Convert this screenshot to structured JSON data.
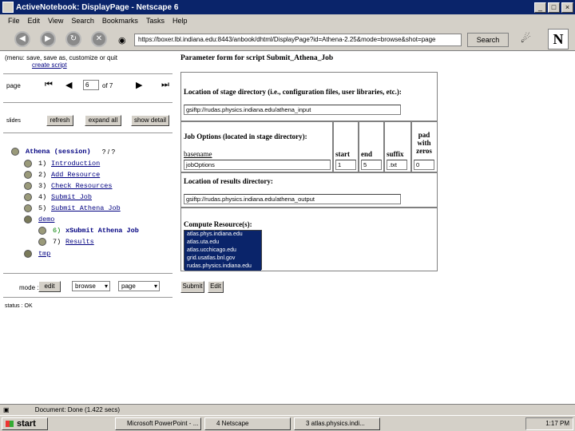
{
  "window": {
    "title": "ActiveNotebook: DisplayPage - Netscape 6"
  },
  "menu": [
    "File",
    "Edit",
    "View",
    "Search",
    "Bookmarks",
    "Tasks",
    "Help"
  ],
  "nav": {
    "url": "https://boxer.lbl.indiana.edu:8443/anbook/dhtml/DisplayPage?id=Athena-2.25&mode=browse&shot=page",
    "search_label": "Search"
  },
  "left": {
    "top_links": "(menu: save, save as, customize or quit",
    "create_script": "create script",
    "page_label": "page",
    "page_value": "6",
    "page_of": "of 7",
    "slides_label": "slides",
    "buttons": [
      "refresh",
      "expand all",
      "show detail"
    ],
    "tree": {
      "session": "Athena (session)",
      "session_help": "? / ?",
      "items": [
        {
          "num": "1)",
          "label": "Introduction"
        },
        {
          "num": "2)",
          "label": "Add Resource"
        },
        {
          "num": "3)",
          "label": "Check Resources"
        },
        {
          "num": "4)",
          "label": "Submit Job"
        },
        {
          "num": "5)",
          "label": "Submit Athena Job"
        }
      ],
      "demo": "demo",
      "demo_items": [
        {
          "num": "6)",
          "label": "xSubmit Athena Job"
        },
        {
          "num": "7)",
          "label": "Results"
        }
      ],
      "tmp": "tmp"
    },
    "mode_label": "mode :",
    "mode_btn": "edit",
    "mode_select": "browse",
    "view_select": "page",
    "status_short": "status : OK"
  },
  "form": {
    "title": "Parameter form for script Submit_Athena_Job",
    "stage_label": "Location of stage directory (i.e., configuration files, user libraries, etc.):",
    "stage_value": "gsiftp://rudas.physics.indiana.edu/athena_input",
    "job_label": "Job Options (located in stage directory):",
    "basename_label": "basename",
    "start_label": "start",
    "end_label": "end",
    "suffix_label": "suffix",
    "pad_label": "pad with zeros",
    "basename_value": "jobOptions",
    "start_value": "1",
    "end_value": "5",
    "suffix_value": ".txt",
    "pad_value": "0",
    "results_label": "Location of results directory:",
    "results_value": "gsiftp://rudas.physics.indiana.edu/athena_output",
    "compute_label": "Compute Resource(s):",
    "compute_items": [
      "atlas.phys.indiana.edu",
      "atlas.uta.edu",
      "atlas.ucchicago.edu",
      "grid.usatlas.bnl.gov",
      "rudas.physics.indiana.edu"
    ],
    "submit": "Submit",
    "edit": "Edit"
  },
  "status": {
    "text": "Document: Done (1.422 secs)"
  },
  "taskbar": {
    "start": "start",
    "tasks": [
      "Microsoft PowerPoint - ...",
      "4 Netscape",
      "3 atlas.physics.indi..."
    ],
    "clock": "1:17 PM"
  }
}
